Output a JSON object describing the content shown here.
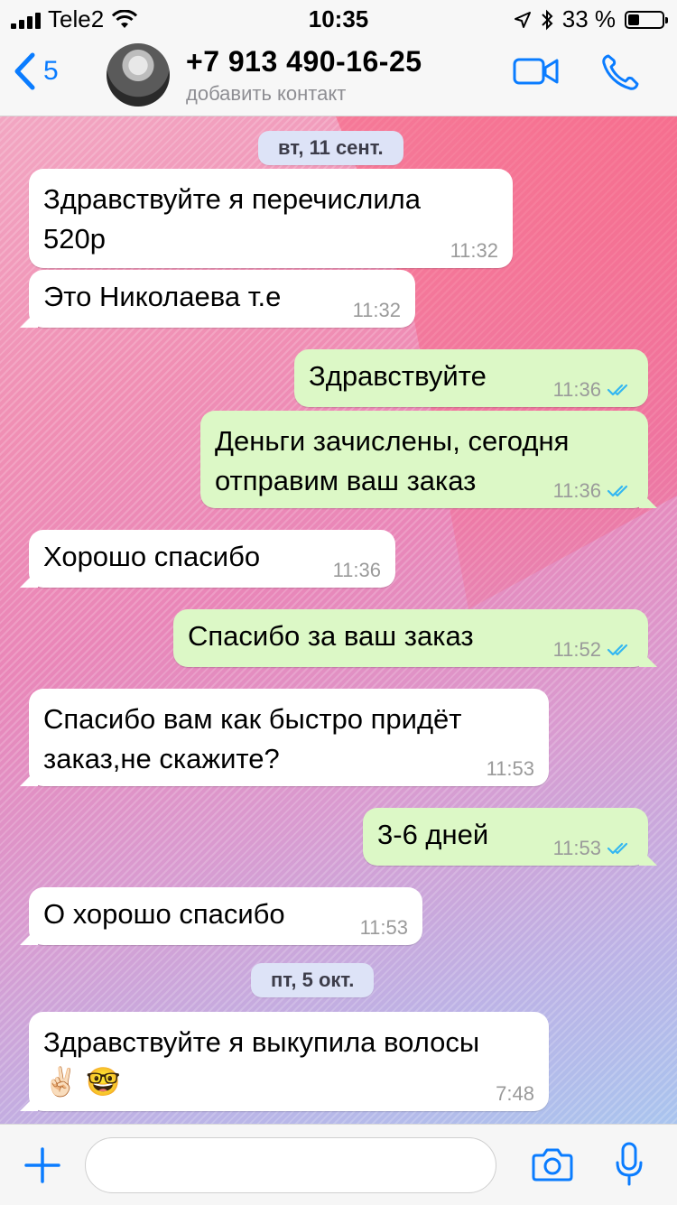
{
  "status": {
    "carrier": "Tele2",
    "time": "10:35",
    "battery": "33 %",
    "battery_level": 0.33
  },
  "header": {
    "back_count": "5",
    "contact_name": "+7 913 490-16-25",
    "contact_subtitle": "добавить контакт"
  },
  "chat": {
    "dates": [
      "вт, 11 сент.",
      "пт, 5 окт."
    ],
    "messages": [
      {
        "line1": "Здравствуйте я перечислила",
        "line2": "520р",
        "time": "11:32",
        "dir": "in"
      },
      {
        "line1": "Это Николаева т.е",
        "time": "11:32",
        "dir": "in"
      },
      {
        "line1": "Здравствуйте",
        "time": "11:36",
        "dir": "out"
      },
      {
        "line1": "Деньги зачислены, сегодня",
        "line2": "отправим ваш заказ",
        "time": "11:36",
        "dir": "out"
      },
      {
        "line1": "Хорошо спасибо",
        "time": "11:36",
        "dir": "in"
      },
      {
        "line1": "Спасибо за ваш заказ",
        "time": "11:52",
        "dir": "out"
      },
      {
        "line1": "Спасибо вам как быстро придёт",
        "line2": "заказ,не скажите?",
        "time": "11:53",
        "dir": "in"
      },
      {
        "line1": "3-6 дней",
        "time": "11:53",
        "dir": "out"
      },
      {
        "line1": "О хорошо спасибо",
        "time": "11:53",
        "dir": "in"
      },
      {
        "line1": "Здравствуйте я выкупила волосы",
        "line2": "✌🏻 🤓",
        "time": "7:48",
        "dir": "in"
      }
    ]
  },
  "input": {
    "placeholder": ""
  },
  "colors": {
    "accent": "#0a7cff",
    "incoming_bubble": "#ffffff",
    "outgoing_bubble": "#dcf8c6",
    "read_ticks": "#34b7f1"
  },
  "icons": [
    "back-chevron-icon",
    "video-call-icon",
    "phone-icon",
    "plus-icon",
    "camera-icon",
    "microphone-icon",
    "double-check-icon"
  ]
}
